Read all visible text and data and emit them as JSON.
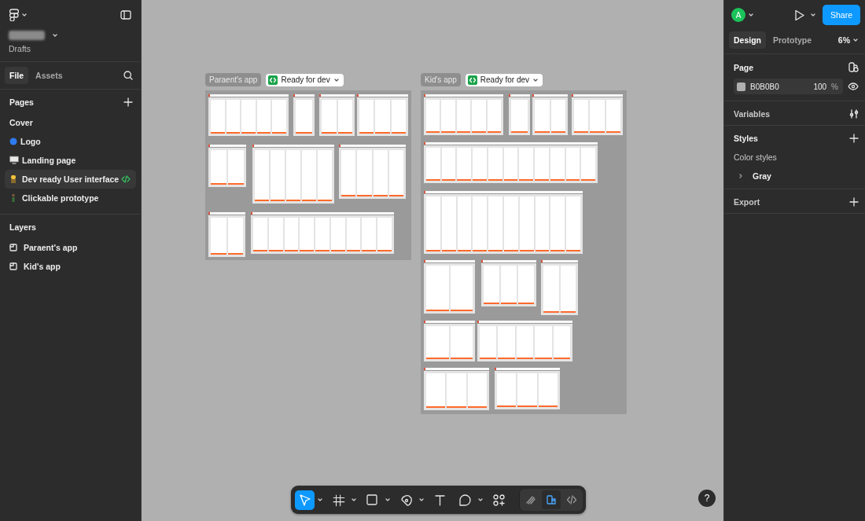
{
  "file": {
    "location": "Drafts"
  },
  "left_tabs": [
    {
      "label": "File",
      "selected": true
    },
    {
      "label": "Assets",
      "selected": false
    }
  ],
  "pages": {
    "title": "Pages",
    "items": [
      {
        "label": "Cover",
        "kind": "plain",
        "selected": false,
        "dev_mode": false
      },
      {
        "label": "Logo",
        "kind": "dot",
        "selected": false,
        "dev_mode": false
      },
      {
        "label": "Landing page",
        "kind": "monitor",
        "selected": false,
        "dev_mode": false
      },
      {
        "label": "Dev ready User interface",
        "kind": "worker",
        "selected": true,
        "dev_mode": true
      },
      {
        "label": "Clickable prototype",
        "kind": "figure",
        "selected": false,
        "dev_mode": false
      }
    ]
  },
  "layers": {
    "title": "Layers",
    "items": [
      {
        "label": "Paraent's app"
      },
      {
        "label": "Kid's app"
      }
    ]
  },
  "canvas": {
    "sections": [
      {
        "name": "Paraent's app",
        "status": "Ready for dev"
      },
      {
        "name": "Kid's app",
        "status": "Ready for dev"
      }
    ]
  },
  "toolbar": {
    "tools": [
      {
        "kind": "move",
        "selected": true,
        "menu": true
      },
      {
        "kind": "frame",
        "selected": false,
        "menu": true
      },
      {
        "kind": "rectangle",
        "selected": false,
        "menu": true
      },
      {
        "kind": "pen",
        "selected": false,
        "menu": true
      },
      {
        "kind": "text",
        "selected": false,
        "menu": false
      },
      {
        "kind": "comment",
        "selected": false,
        "menu": true
      },
      {
        "kind": "actions",
        "selected": false,
        "menu": false
      }
    ],
    "modes": [
      {
        "kind": "draw",
        "selected": false
      },
      {
        "kind": "design",
        "selected": true
      },
      {
        "kind": "dev",
        "selected": false
      }
    ]
  },
  "right_panel": {
    "avatar": "A",
    "share": "Share",
    "tabs": [
      {
        "label": "Design",
        "selected": true
      },
      {
        "label": "Prototype",
        "selected": false
      }
    ],
    "zoom": "6%",
    "page": {
      "title": "Page",
      "color": "B0B0B0",
      "opacity": "100",
      "unit": "%"
    },
    "variables": "Variables",
    "styles": {
      "title": "Styles",
      "group": "Color styles",
      "items": [
        {
          "label": "Gray",
          "expanded": false
        }
      ]
    },
    "export": "Export"
  },
  "help": "?"
}
